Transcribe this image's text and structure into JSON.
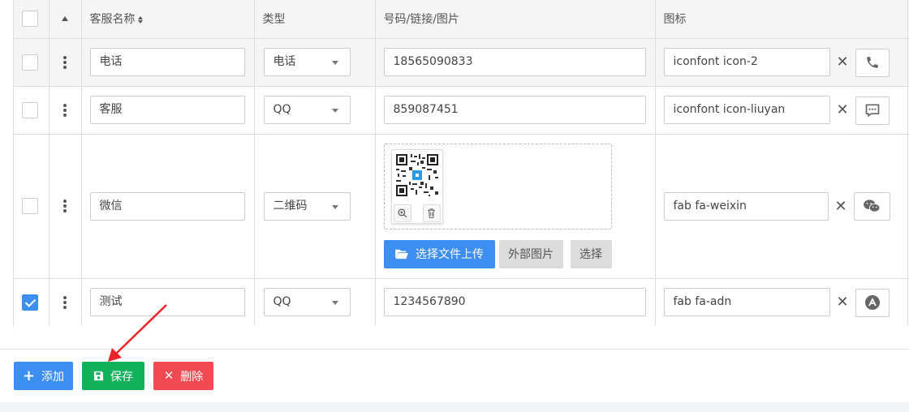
{
  "header": {
    "name": "客服名称",
    "type": "类型",
    "value": "号码/链接/图片",
    "icon": "图标"
  },
  "rows": [
    {
      "checked": false,
      "name": "电话",
      "type": "电话",
      "value": "18565090833",
      "icon_class": "iconfont icon-2",
      "icon_preview": "phone-icon"
    },
    {
      "checked": false,
      "name": "客服",
      "type": "QQ",
      "value": "859087451",
      "icon_class": "iconfont icon-liuyan",
      "icon_preview": "message-icon"
    },
    {
      "checked": false,
      "name": "微信",
      "type": "二维码",
      "value": "",
      "icon_class": "fab fa-weixin",
      "icon_preview": "wechat-icon"
    },
    {
      "checked": true,
      "name": "测试",
      "type": "QQ",
      "value": "1234567890",
      "icon_class": "fab fa-adn",
      "icon_preview": "adn-icon"
    }
  ],
  "upload": {
    "select_upload_label": "选择文件上传",
    "external_label": "外部图片",
    "choose_label": "选择"
  },
  "actions": {
    "add_label": "添加",
    "save_label": "保存",
    "delete_label": "删除"
  },
  "colors": {
    "primary": "#3d8ef1",
    "success": "#12b25c",
    "danger": "#f14a52",
    "annotation_arrow": "#e8232a"
  }
}
